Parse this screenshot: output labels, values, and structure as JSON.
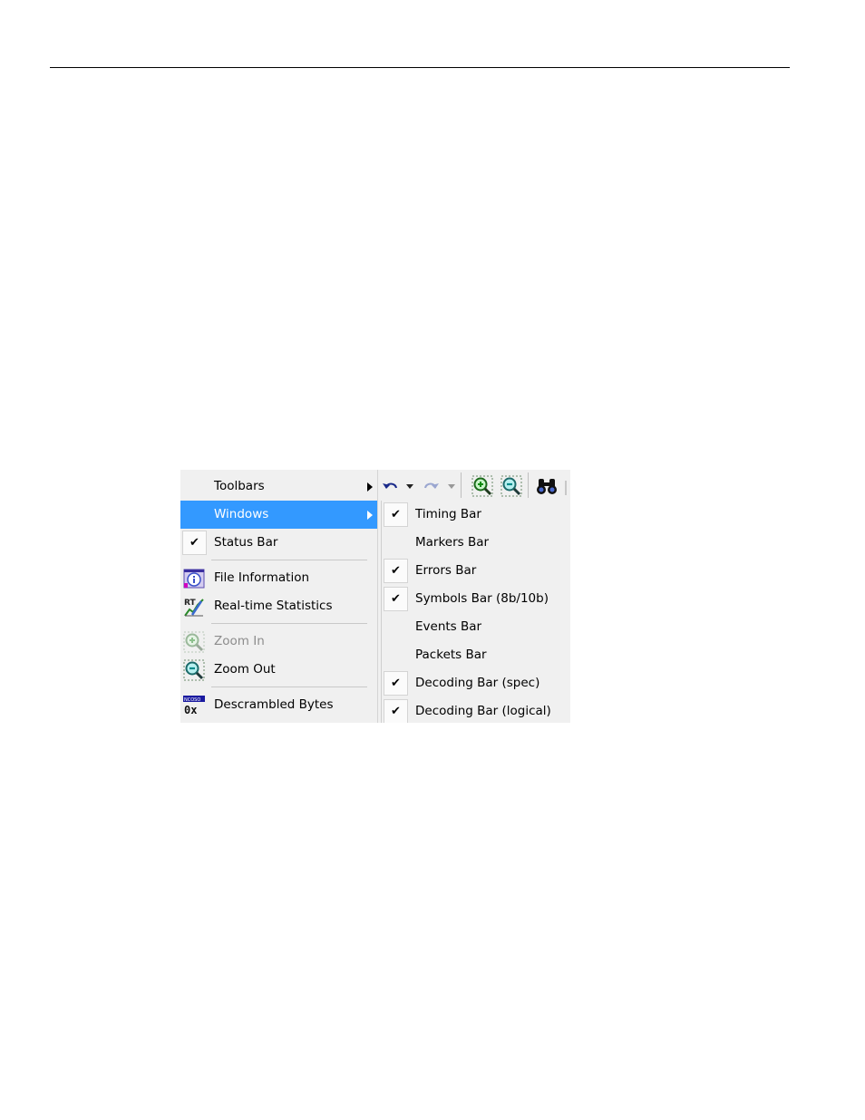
{
  "menu": {
    "items": [
      {
        "label": "Toolbars"
      },
      {
        "label": "Windows"
      },
      {
        "label": "Status Bar",
        "checked": true
      },
      {
        "label": "File Information",
        "icon": "info-icon"
      },
      {
        "label": "Real-time Statistics",
        "icon": "realtime-statistics-icon"
      },
      {
        "label": "Zoom In",
        "icon": "zoom-in-icon",
        "disabled": true
      },
      {
        "label": "Zoom Out",
        "icon": "zoom-out-icon"
      },
      {
        "label": "Descrambled Bytes",
        "icon": "descrambled-bytes-icon"
      }
    ],
    "highlight_color": "#3399ff"
  },
  "toolbar": {
    "icons": [
      "undo-icon",
      "dropdown-icon",
      "redo-icon",
      "dropdown-icon",
      "zoom-in-icon",
      "zoom-out-icon",
      "find-icon"
    ]
  },
  "submenu": {
    "items": [
      {
        "label": "Timing Bar",
        "checked": true
      },
      {
        "label": "Markers Bar",
        "checked": false
      },
      {
        "label": "Errors Bar",
        "checked": true
      },
      {
        "label": "Symbols Bar (8b/10b)",
        "checked": true
      },
      {
        "label": "Events Bar",
        "checked": false
      },
      {
        "label": "Packets Bar",
        "checked": false
      },
      {
        "label": "Decoding Bar (spec)",
        "checked": true
      },
      {
        "label": "Decoding Bar (logical)",
        "checked": true
      }
    ],
    "check_glyph": "✔"
  },
  "icon_texts": {
    "realtime": "RT",
    "descrambled_top": "NCOSO",
    "descrambled_bottom": "0x"
  }
}
